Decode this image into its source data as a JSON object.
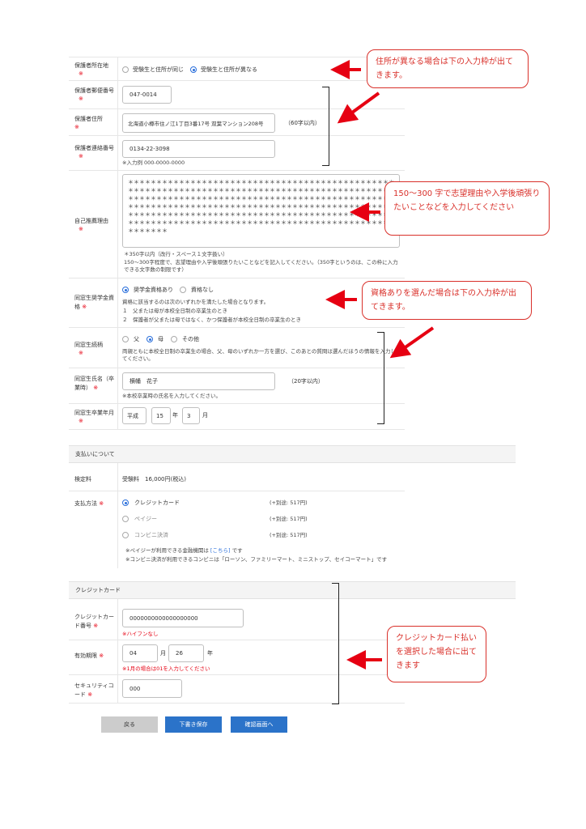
{
  "guardian": {
    "address_type": {
      "label": "保護者所在地",
      "req": "※",
      "opt_same": "受験生と住所が同じ",
      "opt_diff": "受験生と住所が異なる"
    },
    "postal": {
      "label": "保護者郵便番号",
      "req": "※",
      "value": "047-0014"
    },
    "address": {
      "label": "保護者住所",
      "req": "※",
      "value": "北海道小樽市住ノ江1丁目3番17号 双葉マンション208号",
      "limit": "（60字以内）"
    },
    "phone": {
      "label": "保護者連絡番号",
      "req": "※",
      "value": "0134-22-3098",
      "hint": "※入力例 000-0000-0000"
    }
  },
  "reason": {
    "label": "自己推薦理由",
    "req": "※",
    "stars": [
      "＊＊＊＊＊＊＊＊＊＊＊＊＊＊＊＊＊＊＊＊＊＊＊＊＊＊＊＊＊＊＊＊＊＊＊＊＊＊＊＊＊＊＊＊＊＊＊",
      "＊＊＊＊＊＊＊＊＊＊＊＊＊＊＊＊＊＊＊＊＊＊＊＊＊＊＊＊＊＊＊＊＊＊＊＊＊＊＊＊＊＊＊＊＊＊＊",
      "＊＊＊＊＊＊＊＊＊＊＊＊＊＊＊＊＊＊＊＊＊＊＊＊＊＊＊＊＊＊＊＊＊＊＊＊＊＊＊＊＊＊＊＊＊＊＊",
      "＊＊＊＊＊＊＊＊＊＊＊＊＊＊＊＊＊＊＊＊＊＊＊＊＊＊＊＊＊＊＊＊＊＊＊＊＊＊＊＊＊＊＊＊＊＊＊",
      "＊＊＊＊＊＊＊＊＊＊＊＊＊＊＊＊＊＊＊＊＊＊＊＊＊＊＊＊＊＊＊＊＊＊＊＊＊＊＊＊＊＊＊＊＊＊＊",
      "＊＊＊＊＊＊＊＊＊＊＊＊＊＊＊＊＊＊＊＊＊＊＊＊＊＊＊＊＊＊＊＊＊＊＊＊＊＊＊＊＊＊＊＊＊＊＊",
      "＊＊＊＊＊＊＊"
    ],
    "hint1": "＊350字以内（改行・スペース１文字扱い）",
    "hint2": "150～300字程度で、志望理由や入学後頑張りたいことなどを記入してください。（350字というのは、この枠に入力できる文字数の制限です）"
  },
  "alumni": {
    "label": "同窓生奨学金資格",
    "req": "※",
    "opt_yes": "奨学金資格あり",
    "opt_no": "資格なし",
    "note1": "資格に該当するのは次のいずれかを満たした場合となります。",
    "note2": "１　父または母が本校全日制の卒業生のとき",
    "note3": "２　保護者が父または母ではなく、かつ保護者が本校全日制の卒業生のとき"
  },
  "relation": {
    "label": "同窓生続柄",
    "req": "※",
    "opt_father": "父",
    "opt_mother": "母",
    "opt_other": "その他",
    "note": "両親ともに本校全日制の卒業生の場合、父、母のいずれか一方を選び、このあとの質問は選んだほうの情報を入力してください。"
  },
  "alumni_name": {
    "label": "同窓生氏名（卒業時）",
    "req": "※",
    "value": "横幡　花子",
    "limit": "（20字以内）",
    "hint": "※本校卒業時の氏名を入力してください。"
  },
  "alumni_year": {
    "label": "同窓生卒業年月",
    "req": "※",
    "era": "平成",
    "year": "15",
    "year_unit": "年",
    "month": "3",
    "month_unit": "月"
  },
  "payment": {
    "section_title": "支払いについて",
    "fee_label": "検定料",
    "fee_value": "受験料　16,000円(税込)",
    "method_label": "支払方法",
    "req": "※",
    "methods": [
      {
        "name": "クレジットカード",
        "fee": "(+別途: 517円)"
      },
      {
        "name": "ペイジー",
        "fee": "(+別途: 517円)"
      },
      {
        "name": "コンビニ決済",
        "fee": "(+別途: 517円)"
      }
    ],
    "note_pay_pre": "※ペイジーが利用できる金融機関は",
    "note_pay_link": "[こちら]",
    "note_pay_post": "です",
    "note_conv": "※コンビニ決済が利用できるコンビニは「ローソン、ファミリーマート、ミニストップ、セイコーマート」です"
  },
  "card": {
    "section_title": "クレジットカード",
    "number_label": "クレジットカード番号",
    "req": "※",
    "number_value": "0000000000000000000",
    "number_hint": "※ハイフンなし",
    "expiry_label": "有効期限",
    "expiry_month": "04",
    "expiry_month_unit": "月",
    "expiry_year": "26",
    "expiry_year_unit": "年",
    "expiry_hint": "※1月の場合は01を入力してください",
    "cvc_label": "セキュリティコード",
    "cvc_value": "000"
  },
  "buttons": {
    "back": "戻る",
    "draft": "下書き保存",
    "confirm": "確認画面へ"
  },
  "callouts": {
    "address": "住所が異なる場合は下の入力枠が出てきます。",
    "reason": "150～300 字で志望理由や入学後頑張りたいことなどを入力してください",
    "scholarship": "資格ありを選んだ場合は下の入力枠が出てきます。",
    "card": "クレジットカード払いを選択した場合に出てきます"
  },
  "colors": {
    "accent": "#2a6fdb",
    "required": "#e60012",
    "callout": "#d9302a",
    "button_blue": "#2b73c9",
    "button_gray": "#cccccc"
  }
}
